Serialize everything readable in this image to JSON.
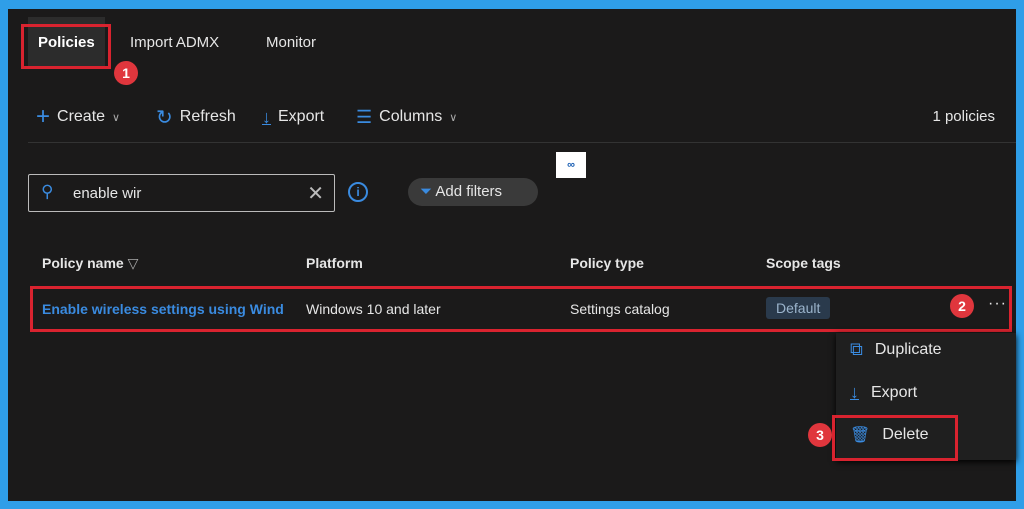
{
  "tabs": [
    {
      "label": "Policies"
    },
    {
      "label": "Import ADMX"
    },
    {
      "label": "Monitor"
    }
  ],
  "toolbar": {
    "create": "Create",
    "refresh": "Refresh",
    "export": "Export",
    "columns": "Columns",
    "count": "1 policies"
  },
  "search": {
    "value": "enable wir"
  },
  "filters": {
    "label": "Add filters"
  },
  "table": {
    "headers": [
      "Policy name",
      "Platform",
      "Policy type",
      "Scope tags"
    ],
    "rows": [
      {
        "name": "Enable wireless settings using Wind",
        "platform": "Windows 10 and later",
        "type": "Settings catalog",
        "scope": "Default"
      }
    ]
  },
  "menu": {
    "items": [
      {
        "label": "Duplicate"
      },
      {
        "label": "Export"
      },
      {
        "label": "Delete"
      }
    ]
  },
  "steps": [
    "1",
    "2",
    "3"
  ],
  "colors": {
    "accent": "#3a8be0",
    "highlight": "#d9232f",
    "frame": "#2f9ee8"
  }
}
